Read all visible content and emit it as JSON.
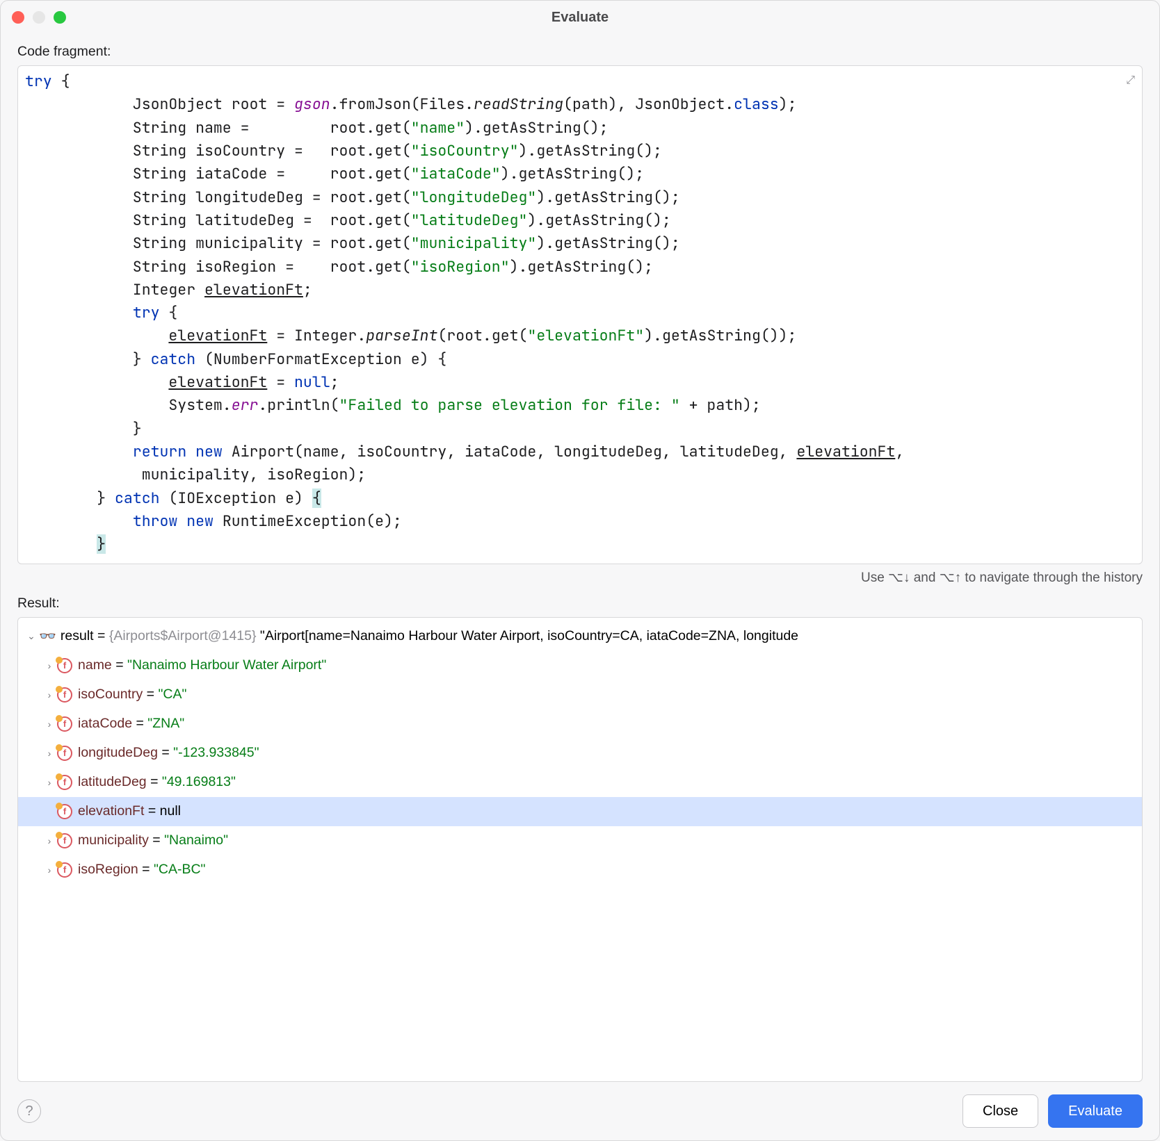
{
  "window": {
    "title": "Evaluate"
  },
  "labels": {
    "code_fragment": "Code fragment:",
    "result": "Result:",
    "hint": "Use ⌥↓ and ⌥↑ to navigate through the history"
  },
  "buttons": {
    "close": "Close",
    "evaluate": "Evaluate"
  },
  "code": {
    "lines": [
      {
        "segments": [
          {
            "t": "try",
            "c": "tok-kw"
          },
          {
            "t": " {"
          }
        ]
      },
      {
        "segments": [
          {
            "t": "            JsonObject root = "
          },
          {
            "t": "gson",
            "c": "tok-fld"
          },
          {
            "t": ".fromJson(Files."
          },
          {
            "t": "readString",
            "c": "tok-stat"
          },
          {
            "t": "(path), JsonObject."
          },
          {
            "t": "class",
            "c": "tok-kw"
          },
          {
            "t": ");"
          }
        ]
      },
      {
        "segments": [
          {
            "t": "            String name =         root.get("
          },
          {
            "t": "\"name\"",
            "c": "tok-str"
          },
          {
            "t": ").getAsString();"
          }
        ]
      },
      {
        "segments": [
          {
            "t": "            String isoCountry =   root.get("
          },
          {
            "t": "\"isoCountry\"",
            "c": "tok-str"
          },
          {
            "t": ").getAsString();"
          }
        ]
      },
      {
        "segments": [
          {
            "t": "            String iataCode =     root.get("
          },
          {
            "t": "\"iataCode\"",
            "c": "tok-str"
          },
          {
            "t": ").getAsString();"
          }
        ]
      },
      {
        "segments": [
          {
            "t": "            String longitudeDeg = root.get("
          },
          {
            "t": "\"longitudeDeg\"",
            "c": "tok-str"
          },
          {
            "t": ").getAsString();"
          }
        ]
      },
      {
        "segments": [
          {
            "t": "            String latitudeDeg =  root.get("
          },
          {
            "t": "\"latitudeDeg\"",
            "c": "tok-str"
          },
          {
            "t": ").getAsString();"
          }
        ]
      },
      {
        "segments": [
          {
            "t": "            String municipality = root.get("
          },
          {
            "t": "\"municipality\"",
            "c": "tok-str"
          },
          {
            "t": ").getAsString();"
          }
        ]
      },
      {
        "segments": [
          {
            "t": "            String isoRegion =    root.get("
          },
          {
            "t": "\"isoRegion\"",
            "c": "tok-str"
          },
          {
            "t": ").getAsString();"
          }
        ]
      },
      {
        "segments": [
          {
            "t": "            Integer "
          },
          {
            "t": "elevationFt",
            "c": "tok-und"
          },
          {
            "t": ";"
          }
        ]
      },
      {
        "segments": [
          {
            "t": "            "
          },
          {
            "t": "try",
            "c": "tok-kw"
          },
          {
            "t": " {"
          }
        ]
      },
      {
        "segments": [
          {
            "t": "                "
          },
          {
            "t": "elevationFt",
            "c": "tok-und"
          },
          {
            "t": " = Integer."
          },
          {
            "t": "parseInt",
            "c": "tok-stat"
          },
          {
            "t": "(root.get("
          },
          {
            "t": "\"elevationFt\"",
            "c": "tok-str"
          },
          {
            "t": ").getAsString());"
          }
        ]
      },
      {
        "segments": [
          {
            "t": "            } "
          },
          {
            "t": "catch",
            "c": "tok-kw"
          },
          {
            "t": " (NumberFormatException e) {"
          }
        ]
      },
      {
        "segments": [
          {
            "t": "                "
          },
          {
            "t": "elevationFt",
            "c": "tok-und"
          },
          {
            "t": " = "
          },
          {
            "t": "null",
            "c": "tok-lit"
          },
          {
            "t": ";"
          }
        ]
      },
      {
        "segments": [
          {
            "t": "                System."
          },
          {
            "t": "err",
            "c": "tok-fld"
          },
          {
            "t": ".println("
          },
          {
            "t": "\"Failed to parse elevation for file: \"",
            "c": "tok-str"
          },
          {
            "t": " + path);"
          }
        ]
      },
      {
        "segments": [
          {
            "t": "            }"
          }
        ]
      },
      {
        "segments": [
          {
            "t": "            "
          },
          {
            "t": "return new",
            "c": "tok-kw"
          },
          {
            "t": " Airport(name, isoCountry, iataCode, longitudeDeg, latitudeDeg, "
          },
          {
            "t": "elevationFt",
            "c": "tok-und"
          },
          {
            "t": ","
          }
        ]
      },
      {
        "segments": [
          {
            "t": "             municipality, isoRegion);"
          }
        ]
      },
      {
        "segments": [
          {
            "t": "        } "
          },
          {
            "t": "catch",
            "c": "tok-kw"
          },
          {
            "t": " (IOException e) "
          },
          {
            "t": "{",
            "c": "hl"
          }
        ]
      },
      {
        "segments": [
          {
            "t": "            "
          },
          {
            "t": "throw new",
            "c": "tok-kw"
          },
          {
            "t": " RuntimeException(e);"
          }
        ]
      },
      {
        "segments": [
          {
            "t": "        "
          },
          {
            "t": "}",
            "c": "hl"
          }
        ]
      }
    ]
  },
  "result": {
    "root": {
      "name": "result",
      "typeinfo": "{Airports$Airport@1415}",
      "summary": "\"Airport[name=Nanaimo Harbour Water Airport, isoCountry=CA, iataCode=ZNA, longitude"
    },
    "fields": [
      {
        "name": "name",
        "value": "\"Nanaimo Harbour Water Airport\"",
        "kind": "str",
        "expandable": true
      },
      {
        "name": "isoCountry",
        "value": "\"CA\"",
        "kind": "str",
        "expandable": true
      },
      {
        "name": "iataCode",
        "value": "\"ZNA\"",
        "kind": "str",
        "expandable": true
      },
      {
        "name": "longitudeDeg",
        "value": "\"-123.933845\"",
        "kind": "str",
        "expandable": true
      },
      {
        "name": "latitudeDeg",
        "value": "\"49.169813\"",
        "kind": "str",
        "expandable": true
      },
      {
        "name": "elevationFt",
        "value": "null",
        "kind": "null",
        "expandable": false,
        "selected": true
      },
      {
        "name": "municipality",
        "value": "\"Nanaimo\"",
        "kind": "str",
        "expandable": true
      },
      {
        "name": "isoRegion",
        "value": "\"CA-BC\"",
        "kind": "str",
        "expandable": true
      }
    ]
  }
}
